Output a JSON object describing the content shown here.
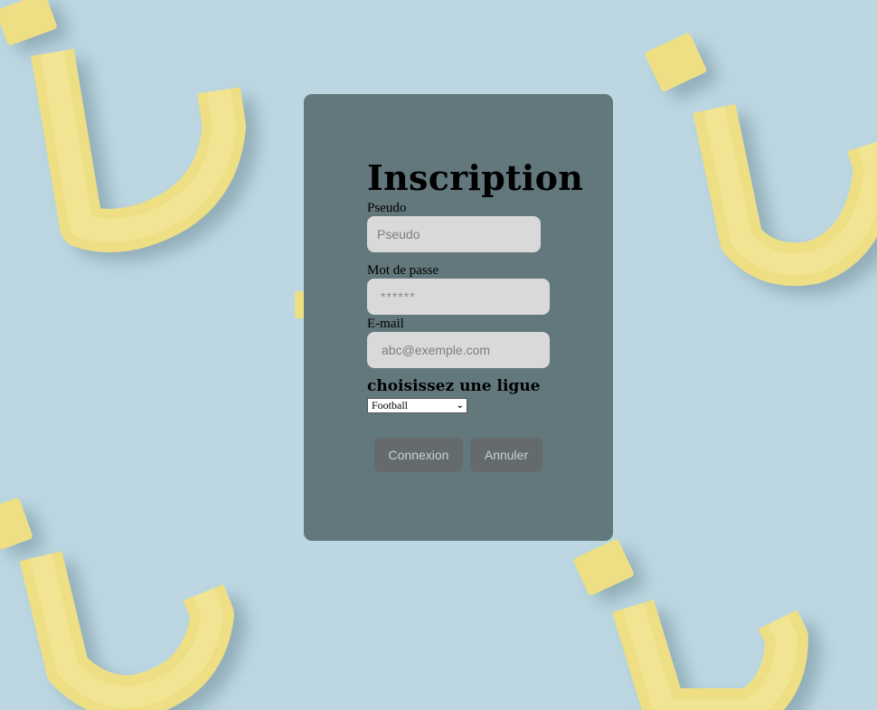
{
  "form": {
    "title": "Inscription",
    "pseudo": {
      "label": "Pseudo",
      "placeholder": "Pseudo"
    },
    "password": {
      "label": "Mot de passe",
      "placeholder": "******"
    },
    "email": {
      "label": "E-mail",
      "placeholder": "abc@exemple.com"
    },
    "league": {
      "label": "choisissez une ligue",
      "selected": "Football"
    },
    "buttons": {
      "connexion": "Connexion",
      "annuler": "Annuler"
    }
  },
  "colors": {
    "background": "#bcd7e1",
    "card": "#62787c",
    "input": "#d9d9d9",
    "button": "#656b6c",
    "button_text": "#c3d4da",
    "decor": "#f0e38a"
  }
}
